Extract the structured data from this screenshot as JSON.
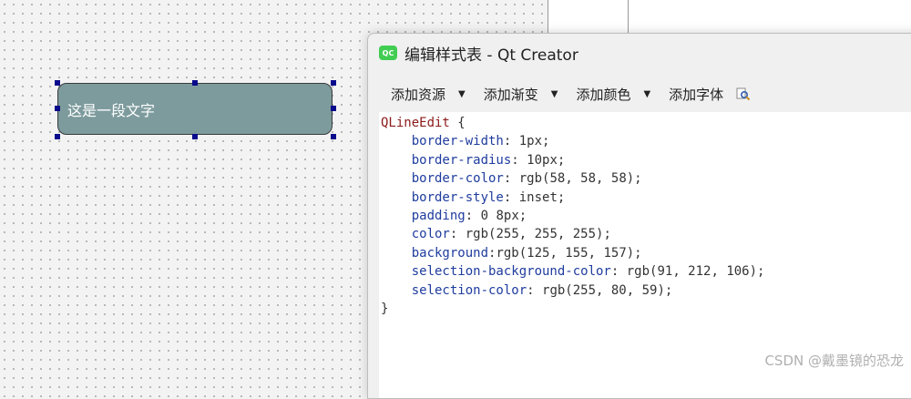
{
  "form": {
    "line_edit_text": "这是一段文字"
  },
  "window": {
    "title": "编辑样式表 - Qt Creator",
    "logo_text": "QC"
  },
  "toolbar": {
    "add_resource": "添加资源",
    "add_gradient": "添加渐变",
    "add_color": "添加颜色",
    "add_font": "添加字体",
    "dropdown_glyph": "▼",
    "preview_icon": "magnifier-icon"
  },
  "stylesheet": {
    "selector": "QLineEdit",
    "open_brace": " {",
    "close_brace": "}",
    "properties": [
      {
        "name": "border-width",
        "value": " 1px;"
      },
      {
        "name": "border-radius",
        "value": " 10px;"
      },
      {
        "name": "border-color",
        "value": " rgb(58, 58, 58);"
      },
      {
        "name": "border-style",
        "value": " inset;"
      },
      {
        "name": "padding",
        "value": " 0 8px;"
      },
      {
        "name": "color",
        "value": " rgb(255, 255, 255);"
      },
      {
        "name": "background",
        "value": "rgb(125, 155, 157);"
      },
      {
        "name": "selection-background-color",
        "value": " rgb(91, 212, 106);"
      },
      {
        "name": "selection-color",
        "value": " rgb(255, 80, 59);"
      }
    ]
  },
  "watermark": "CSDN @戴墨镜的恐龙",
  "colors": {
    "line_edit_bg": "#7d9b9d",
    "line_edit_border": "#3a3a3a",
    "selector": "#8b1a1a",
    "property": "#1f3c9e",
    "qt_green": "#41cd52"
  }
}
